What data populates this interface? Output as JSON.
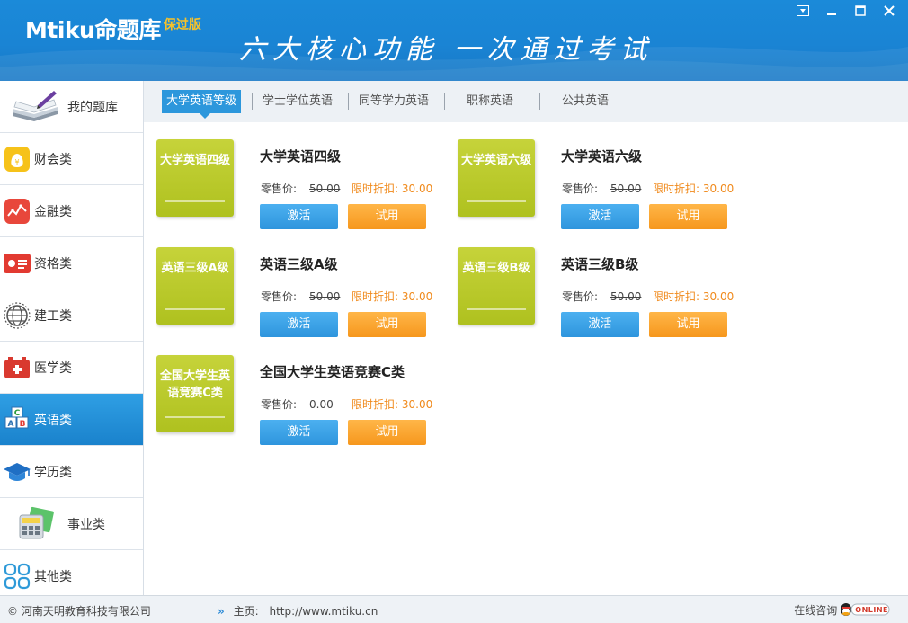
{
  "app": {
    "logo": "Mtiku命题库",
    "logo_sub": "保过版",
    "slogan": "六大核心功能 一次通过考试"
  },
  "sidebar": {
    "items": [
      {
        "label": "我的题库",
        "icon": "book-pen-icon"
      },
      {
        "label": "财会类",
        "icon": "money-bag-icon"
      },
      {
        "label": "金融类",
        "icon": "chart-icon"
      },
      {
        "label": "资格类",
        "icon": "id-card-icon"
      },
      {
        "label": "建工类",
        "icon": "globe-icon"
      },
      {
        "label": "医学类",
        "icon": "medical-kit-icon"
      },
      {
        "label": "英语类",
        "icon": "abc-blocks-icon"
      },
      {
        "label": "学历类",
        "icon": "graduation-cap-icon"
      },
      {
        "label": "事业类",
        "icon": "calculator-icon"
      },
      {
        "label": "其他类",
        "icon": "grid-icon"
      }
    ],
    "active_index": 6
  },
  "tabs": [
    "大学英语等级",
    "学士学位英语",
    "同等学力英语",
    "职称英语",
    "公共英语"
  ],
  "products": [
    {
      "thumb": "大学英语四级",
      "title": "大学英语四级",
      "price_label": "零售价:",
      "price": "50.00",
      "discount": "限时折扣: 30.00",
      "activate": "激活",
      "trial": "试用"
    },
    {
      "thumb": "大学英语六级",
      "title": "大学英语六级",
      "price_label": "零售价:",
      "price": "50.00",
      "discount": "限时折扣: 30.00",
      "activate": "激活",
      "trial": "试用"
    },
    {
      "thumb": "英语三级A级",
      "title": "英语三级A级",
      "price_label": "零售价:",
      "price": "50.00",
      "discount": "限时折扣: 30.00",
      "activate": "激活",
      "trial": "试用"
    },
    {
      "thumb": "英语三级B级",
      "title": "英语三级B级",
      "price_label": "零售价:",
      "price": "50.00",
      "discount": "限时折扣: 30.00",
      "activate": "激活",
      "trial": "试用"
    },
    {
      "thumb": "全国大学生英语竞赛C类",
      "title": "全国大学生英语竞赛C类",
      "price_label": "零售价:",
      "price": "0.00",
      "discount": "限时折扣: 30.00",
      "activate": "激活",
      "trial": "试用"
    }
  ],
  "footer": {
    "copyright": "© 河南天明教育科技有限公司",
    "home_label": "主页:",
    "home_url": "http://www.mtiku.cn",
    "online_label": "在线咨询",
    "online_badge": "ONLINE"
  },
  "colors": {
    "header_blue": "#1a84d4",
    "active_blue": "#2c97dc",
    "thumb_green": "#b9c928",
    "button_blue": "#3aa2e6",
    "button_orange": "#f8a22e",
    "discount_orange": "#f08a1c"
  }
}
